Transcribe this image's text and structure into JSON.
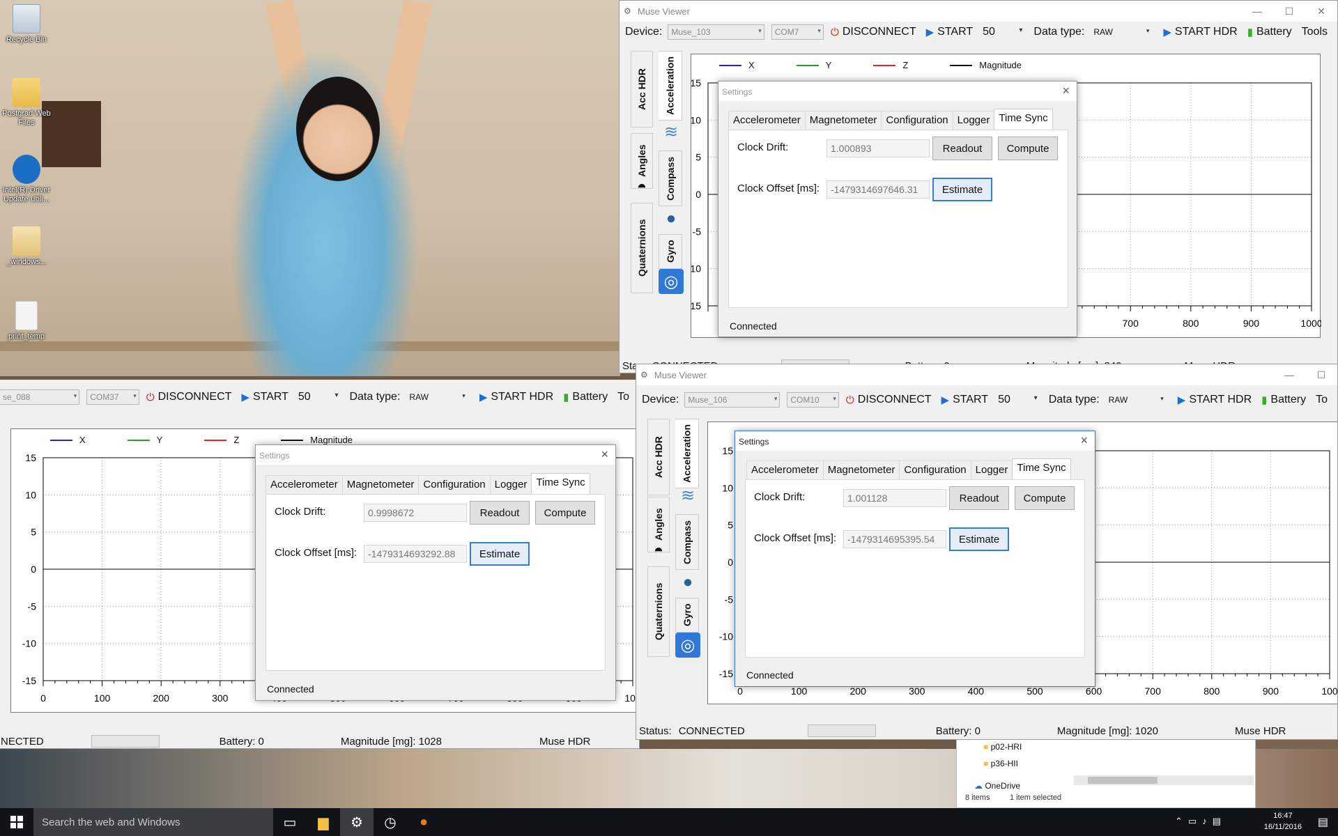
{
  "desktop": {
    "icons": [
      {
        "label": "Recycle Bin",
        "icon": "recycle-bin-icon"
      },
      {
        "label": "Postgrad Web Files",
        "icon": "folder-shortcut-icon"
      },
      {
        "label": "Intel(R) Driver Update Utili...",
        "icon": "intel-icon"
      },
      {
        "label": "_windows...",
        "icon": "folder-icon"
      },
      {
        "label": "print_temp",
        "icon": "pdf-icon"
      }
    ]
  },
  "windows": {
    "top": {
      "title": "Muse Viewer",
      "device_label": "Device:",
      "device_value": "Muse_103",
      "port_value": "COM7",
      "disconnect_label": "DISCONNECT",
      "start_label": "START",
      "rate_value": "50",
      "datatype_label": "Data type:",
      "datatype_value": "RAW",
      "start_hdr_label": "START HDR",
      "battery_label": "Battery",
      "tools_label": "Tools",
      "status_label": "Sta",
      "status_value": "CONNECTED",
      "battery_status": "Battery:   0",
      "magnitude_status": "Magnitude [mg]:   840",
      "hdr_status": "Muse HDR",
      "x_ticks": [
        "700",
        "800",
        "900",
        "1000"
      ]
    },
    "left": {
      "device_value": "se_088",
      "port_value": "COM37",
      "disconnect_label": "DISCONNECT",
      "start_label": "START",
      "rate_value": "50",
      "datatype_label": "Data type:",
      "datatype_value": "RAW",
      "start_hdr_label": "START HDR",
      "battery_label": "Battery",
      "tools_label": "To",
      "status_value": "NECTED",
      "battery_status": "Battery:   0",
      "magnitude_status": "Magnitude [mg]:   1028",
      "hdr_status": "Muse HDR",
      "x_ticks": [
        "0",
        "100",
        "200",
        "300",
        "400",
        "500",
        "600",
        "700",
        "800",
        "900",
        "100"
      ]
    },
    "right": {
      "title": "Muse Viewer",
      "device_label": "Device:",
      "device_value": "Muse_106",
      "port_value": "COM10",
      "disconnect_label": "DISCONNECT",
      "start_label": "START",
      "rate_value": "50",
      "datatype_label": "Data type:",
      "datatype_value": "RAW",
      "start_hdr_label": "START HDR",
      "battery_label": "Battery",
      "tools_label": "To",
      "status_label": "Status:",
      "status_value": "CONNECTED",
      "battery_status": "Battery:   0",
      "magnitude_status": "Magnitude [mg]:   1020",
      "hdr_status": "Muse HDR",
      "x_ticks": [
        "0",
        "100",
        "200",
        "300",
        "400",
        "500",
        "600",
        "700",
        "800",
        "900",
        "100"
      ]
    }
  },
  "side_tabs": {
    "acc_hdr": "Acc HDR",
    "acceleration": "Acceleration",
    "angles": "Angles",
    "compass": "Compass",
    "quaternions": "Quaternions",
    "gyro": "Gyro"
  },
  "legend": {
    "x": "X",
    "y": "Y",
    "z": "Z",
    "magnitude": "Magnitude"
  },
  "y_ticks": [
    "15",
    "10",
    "5",
    "0",
    "-5",
    "-10",
    "-15"
  ],
  "dialogs": {
    "top": {
      "title": "Settings",
      "clock_drift": "1.000893",
      "clock_offset": "-1479314697646.31",
      "status": "Connected"
    },
    "left": {
      "title": "Settings",
      "clock_drift": "0.9998672",
      "clock_offset": "-1479314693292.88",
      "status": "Connected"
    },
    "right": {
      "title": "Settings",
      "clock_drift": "1.001128",
      "clock_offset": "-1479314695395.54",
      "status": "Connected"
    }
  },
  "dialog_labels": {
    "tabs": [
      "Accelerometer",
      "Magnetometer",
      "Configuration",
      "Logger",
      "Time Sync"
    ],
    "clock_drift_label": "Clock Drift:",
    "clock_offset_label": "Clock Offset [ms]:",
    "readout_label": "Readout",
    "compute_label": "Compute",
    "estimate_label": "Estimate"
  },
  "explorer": {
    "items": [
      "p02-HRI",
      "p36-HII",
      "OneDrive"
    ],
    "count": "8 items",
    "selected": "1 item selected"
  },
  "taskbar": {
    "search_placeholder": "Search the web and Windows",
    "time": "16:47",
    "date": "16/11/2016"
  },
  "colors": {
    "x": "#2222ee",
    "y": "#22a022",
    "z": "#ee2222",
    "magnitude": "#111111",
    "accent": "#2b79d6"
  }
}
